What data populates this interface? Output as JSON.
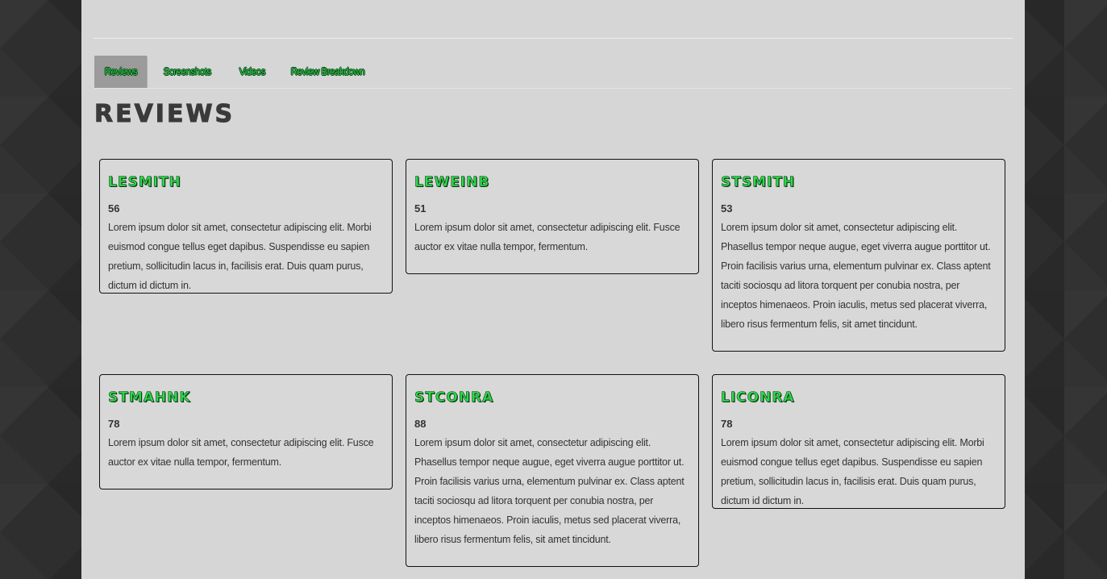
{
  "tabs": [
    {
      "label": "Reviews"
    },
    {
      "label": "Screenshots"
    },
    {
      "label": "Videos"
    },
    {
      "label": "Review Breakdown"
    }
  ],
  "section": {
    "title": "Reviews"
  },
  "reviews": [
    {
      "user": "LESMITH",
      "score": "56",
      "text": "Lorem ipsum dolor sit amet, consectetur adipiscing elit. Morbi euismod congue tellus eget dapibus. Suspendisse eu sapien pretium, sollicitudin lacus in, facilisis erat. Duis quam purus, dictum id dictum in."
    },
    {
      "user": "LEWEINB",
      "score": "51",
      "text": "Lorem ipsum dolor sit amet, consectetur adipiscing elit. Fusce auctor ex vitae nulla tempor, fermentum."
    },
    {
      "user": "STSMITH",
      "score": "53",
      "text": "Lorem ipsum dolor sit amet, consectetur adipiscing elit. Phasellus tempor neque augue, eget viverra augue porttitor ut. Proin facilisis varius urna, elementum pulvinar ex. Class aptent taciti sociosqu ad litora torquent per conubia nostra, per inceptos himenaeos. Proin iaculis, metus sed placerat viverra, libero risus fermentum felis, sit amet tincidunt."
    },
    {
      "user": "STMAHNK",
      "score": "78",
      "text": "Lorem ipsum dolor sit amet, consectetur adipiscing elit. Fusce auctor ex vitae nulla tempor, fermentum."
    },
    {
      "user": "STCONRA",
      "score": "88",
      "text": "Lorem ipsum dolor sit amet, consectetur adipiscing elit. Phasellus tempor neque augue, eget viverra augue porttitor ut. Proin facilisis varius urna, elementum pulvinar ex. Class aptent taciti sociosqu ad litora torquent per conubia nostra, per inceptos himenaeos. Proin iaculis, metus sed placerat viverra, libero risus fermentum felis, sit amet tincidunt."
    },
    {
      "user": "LICONRA",
      "score": "78",
      "text": "Lorem ipsum dolor sit amet, consectetur adipiscing elit. Morbi euismod congue tellus eget dapibus. Suspendisse eu sapien pretium, sollicitudin lacus in, facilisis erat. Duis quam purus, dictum id dictum in."
    }
  ]
}
